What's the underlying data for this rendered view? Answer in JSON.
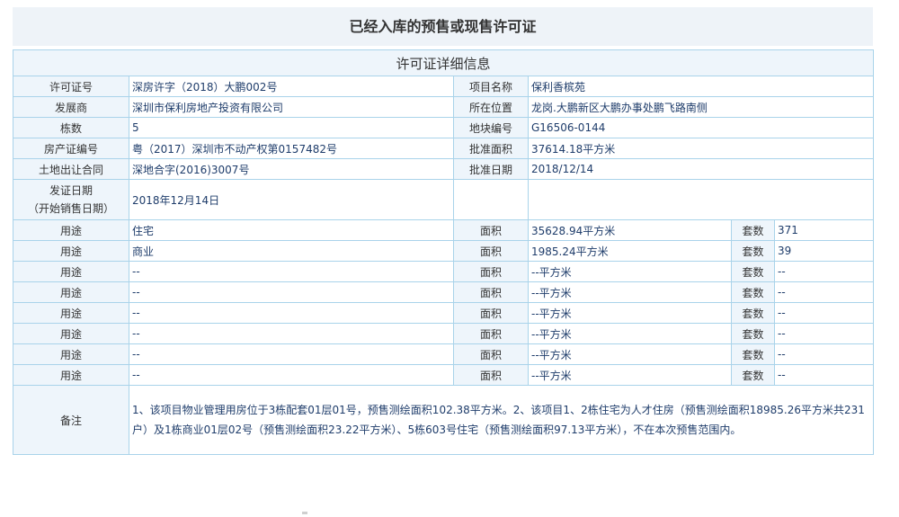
{
  "page": {
    "title": "已经入库的预售或现售许可证",
    "section_title": "许可证详细信息"
  },
  "info": {
    "permit_no": {
      "label": "许可证号",
      "value": "深房许字（2018）大鹏002号"
    },
    "project_name": {
      "label": "项目名称",
      "value": "保利香槟苑"
    },
    "developer": {
      "label": "发展商",
      "value": "深圳市保利房地产投资有限公司"
    },
    "location": {
      "label": "所在位置",
      "value": "龙岗.大鹏新区大鹏办事处鹏飞路南侧"
    },
    "buildings": {
      "label": "栋数",
      "value": "5"
    },
    "parcel_no": {
      "label": "地块编号",
      "value": "G16506-0144"
    },
    "property_cert": {
      "label": "房产证编号",
      "value": "粤（2017）深圳市不动产权第0157482号"
    },
    "approved_area": {
      "label": "批准面积",
      "value": "37614.18平方米"
    },
    "land_contract": {
      "label": "土地出让合同",
      "value": "深地合字(2016)3007号"
    },
    "approved_date": {
      "label": "批准日期",
      "value": "2018/12/14"
    },
    "issue_date": {
      "label_line1": "发证日期",
      "label_line2": "（开始销售日期）",
      "value": "2018年12月14日"
    }
  },
  "usage_labels": {
    "usage": "用途",
    "area": "面积",
    "units": "套数"
  },
  "usage_rows": [
    {
      "usage": "住宅",
      "area": "35628.94平方米",
      "units": "371"
    },
    {
      "usage": "商业",
      "area": "1985.24平方米",
      "units": "39"
    },
    {
      "usage": "--",
      "area": "--平方米",
      "units": "--"
    },
    {
      "usage": "--",
      "area": "--平方米",
      "units": "--"
    },
    {
      "usage": "--",
      "area": "--平方米",
      "units": "--"
    },
    {
      "usage": "--",
      "area": "--平方米",
      "units": "--"
    },
    {
      "usage": "--",
      "area": "--平方米",
      "units": "--"
    },
    {
      "usage": "--",
      "area": "--平方米",
      "units": "--"
    }
  ],
  "remarks": {
    "label": "备注",
    "text": "1、该项目物业管理用房位于3栋配套01层01号，预售测绘面积102.38平方米。2、该项目1、2栋住宅为人才住房（预售测绘面积18985.26平方米共231户）及1栋商业01层02号（预售测绘面积23.22平方米）、5栋603号住宅（预售测绘面积97.13平方米），不在本次预售范围内。"
  }
}
